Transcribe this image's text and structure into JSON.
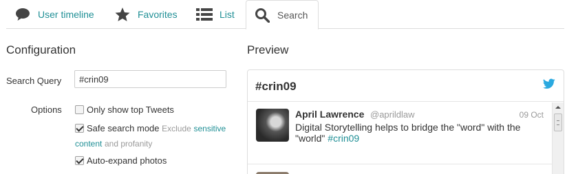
{
  "tabs": [
    {
      "label": "User timeline",
      "icon": "speech-bubble-icon"
    },
    {
      "label": "Favorites",
      "icon": "star-icon"
    },
    {
      "label": "List",
      "icon": "list-icon"
    },
    {
      "label": "Search",
      "icon": "search-icon",
      "active": true
    }
  ],
  "config": {
    "title": "Configuration",
    "search_query_label": "Search Query",
    "search_query_value": "#crin09",
    "options_label": "Options",
    "options": [
      {
        "label": "Only show top Tweets",
        "checked": false
      },
      {
        "label": "Safe search mode",
        "checked": true,
        "note_before": "Exclude",
        "note_link": "sensitive content",
        "note_after": "and profanity"
      },
      {
        "label": "Auto-expand photos",
        "checked": true
      }
    ]
  },
  "preview": {
    "title": "Preview",
    "widget_title": "#crin09",
    "tweet": {
      "author": "April Lawrence",
      "handle": "@aprildlaw",
      "date": "09 Oct",
      "text": "Digital Storytelling helps to bridge the \"word\" with the \"world\"",
      "hashtag": "#crin09"
    }
  },
  "colors": {
    "accent": "#1f8f95",
    "twitter": "#2aa9e0"
  }
}
